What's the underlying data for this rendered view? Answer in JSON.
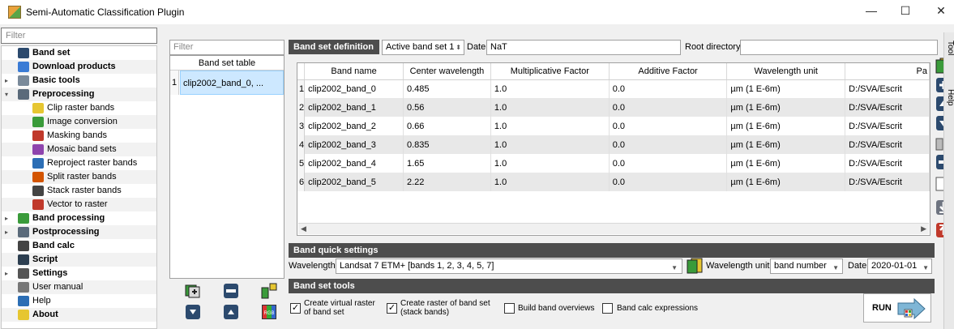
{
  "window": {
    "title": "Semi-Automatic Classification Plugin",
    "minimize": "—",
    "maximize": "☐",
    "close": "✕"
  },
  "menu": {
    "filter_placeholder": "Filter",
    "items": [
      {
        "label": "Band set",
        "bold": true,
        "level": 0,
        "arrow": "",
        "icon": "band-set-icon"
      },
      {
        "label": "Download products",
        "bold": true,
        "level": 0,
        "arrow": "",
        "icon": "download-icon"
      },
      {
        "label": "Basic tools",
        "bold": true,
        "level": 0,
        "arrow": "▸",
        "icon": "basic-tools-icon"
      },
      {
        "label": "Preprocessing",
        "bold": true,
        "level": 0,
        "arrow": "▾",
        "icon": "preprocessing-icon"
      },
      {
        "label": "Clip raster bands",
        "bold": false,
        "level": 1,
        "icon": "clip-icon"
      },
      {
        "label": "Image conversion",
        "bold": false,
        "level": 1,
        "icon": "image-conversion-icon"
      },
      {
        "label": "Masking bands",
        "bold": false,
        "level": 1,
        "icon": "masking-icon"
      },
      {
        "label": "Mosaic band sets",
        "bold": false,
        "level": 1,
        "icon": "mosaic-icon"
      },
      {
        "label": "Reproject raster bands",
        "bold": false,
        "level": 1,
        "icon": "reproject-icon"
      },
      {
        "label": "Split raster bands",
        "bold": false,
        "level": 1,
        "icon": "split-icon"
      },
      {
        "label": "Stack raster bands",
        "bold": false,
        "level": 1,
        "icon": "stack-icon"
      },
      {
        "label": "Vector to raster",
        "bold": false,
        "level": 1,
        "icon": "vector-to-raster-icon"
      },
      {
        "label": "Band processing",
        "bold": true,
        "level": 0,
        "arrow": "▸",
        "icon": "band-processing-icon"
      },
      {
        "label": "Postprocessing",
        "bold": true,
        "level": 0,
        "arrow": "▸",
        "icon": "postprocessing-icon"
      },
      {
        "label": "Band calc",
        "bold": true,
        "level": 0,
        "arrow": "",
        "icon": "band-calc-icon"
      },
      {
        "label": "Script",
        "bold": true,
        "level": 0,
        "arrow": "",
        "icon": "script-icon"
      },
      {
        "label": "Settings",
        "bold": true,
        "level": 0,
        "arrow": "▸",
        "icon": "settings-icon"
      },
      {
        "label": "User manual",
        "bold": false,
        "level": 0,
        "arrow": "",
        "icon": "user-manual-icon"
      },
      {
        "label": "Help",
        "bold": false,
        "level": 0,
        "arrow": "",
        "icon": "help-icon"
      },
      {
        "label": "About",
        "bold": true,
        "level": 0,
        "arrow": "",
        "icon": "about-icon"
      }
    ]
  },
  "band_set_table": {
    "filter_placeholder": "Filter",
    "header": "Band set table",
    "rows": [
      {
        "num": "1",
        "value": "clip2002_band_0, ..."
      }
    ]
  },
  "definition": {
    "section_label": "Band set definition",
    "active_band_set": "Active band set 1",
    "date_label": "Date",
    "date_value": "NaT",
    "root_label": "Root directory",
    "root_value": ""
  },
  "bands_table": {
    "columns": [
      "Band name",
      "Center wavelength",
      "Multiplicative Factor",
      "Additive Factor",
      "Wavelength unit",
      "Pa"
    ],
    "rows": [
      {
        "num": "1",
        "name": "clip2002_band_0",
        "wl": "0.485",
        "mult": "1.0",
        "add": "0.0",
        "unit": "µm (1 E-6m)",
        "path": "D:/SVA/Escrit"
      },
      {
        "num": "2",
        "name": "clip2002_band_1",
        "wl": "0.56",
        "mult": "1.0",
        "add": "0.0",
        "unit": "µm (1 E-6m)",
        "path": "D:/SVA/Escrit"
      },
      {
        "num": "3",
        "name": "clip2002_band_2",
        "wl": "0.66",
        "mult": "1.0",
        "add": "0.0",
        "unit": "µm (1 E-6m)",
        "path": "D:/SVA/Escrit"
      },
      {
        "num": "4",
        "name": "clip2002_band_3",
        "wl": "0.835",
        "mult": "1.0",
        "add": "0.0",
        "unit": "µm (1 E-6m)",
        "path": "D:/SVA/Escrit"
      },
      {
        "num": "5",
        "name": "clip2002_band_4",
        "wl": "1.65",
        "mult": "1.0",
        "add": "0.0",
        "unit": "µm (1 E-6m)",
        "path": "D:/SVA/Escrit"
      },
      {
        "num": "6",
        "name": "clip2002_band_5",
        "wl": "2.22",
        "mult": "1.0",
        "add": "0.0",
        "unit": "µm (1 E-6m)",
        "path": "D:/SVA/Escrit"
      }
    ]
  },
  "quick_settings": {
    "section_label": "Band quick settings",
    "wavelength_label": "Wavelength",
    "wavelength_value": "Landsat 7 ETM+ [bands 1, 2, 3, 4, 5, 7]",
    "unit_label": "Wavelength unit",
    "unit_value": "band number",
    "date_label": "Date",
    "date_value": "2020-01-01"
  },
  "tools": {
    "section_label": "Band set tools",
    "virtual_raster_label": "Create virtual raster\nof band set",
    "virtual_raster_checked": true,
    "stack_label": "Create raster of band set\n(stack bands)",
    "stack_checked": true,
    "overviews_label": "Build band overviews",
    "overviews_checked": false,
    "calc_label": "Band calc expressions",
    "calc_checked": false,
    "run_label": "RUN"
  },
  "dock_tabs": [
    "Tool",
    "Help"
  ],
  "colors": {
    "section_bg": "#4d4d4d",
    "selection": "#cde8ff",
    "row_alt": "#e8e8e8"
  }
}
